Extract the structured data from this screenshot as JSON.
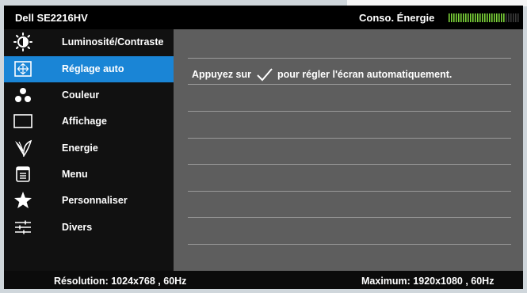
{
  "header": {
    "model": "Dell SE2216HV",
    "energy_label": "Conso. Énergie",
    "energy_level": 0.8,
    "energy_color": "#7dd63a"
  },
  "menu": {
    "items": [
      {
        "label": "Luminosité/Contraste",
        "icon": "brightness-icon",
        "active": false
      },
      {
        "label": "Réglage auto",
        "icon": "auto-adjust-icon",
        "active": true
      },
      {
        "label": "Couleur",
        "icon": "color-dots-icon",
        "active": false
      },
      {
        "label": "Affichage",
        "icon": "display-icon",
        "active": false
      },
      {
        "label": "Energie",
        "icon": "energy-leaf-icon",
        "active": false
      },
      {
        "label": "Menu",
        "icon": "menu-icon",
        "active": false
      },
      {
        "label": "Personnaliser",
        "icon": "star-icon",
        "active": false
      },
      {
        "label": "Divers",
        "icon": "sliders-icon",
        "active": false
      }
    ],
    "active_color": "#1a85d6"
  },
  "content": {
    "instruction_before": "Appuyez sur",
    "instruction_after": "pour régler l'écran automatiquement."
  },
  "footer": {
    "resolution": "Résolution: 1024x768 , 60Hz",
    "maximum": "Maximum: 1920x1080 , 60Hz"
  }
}
